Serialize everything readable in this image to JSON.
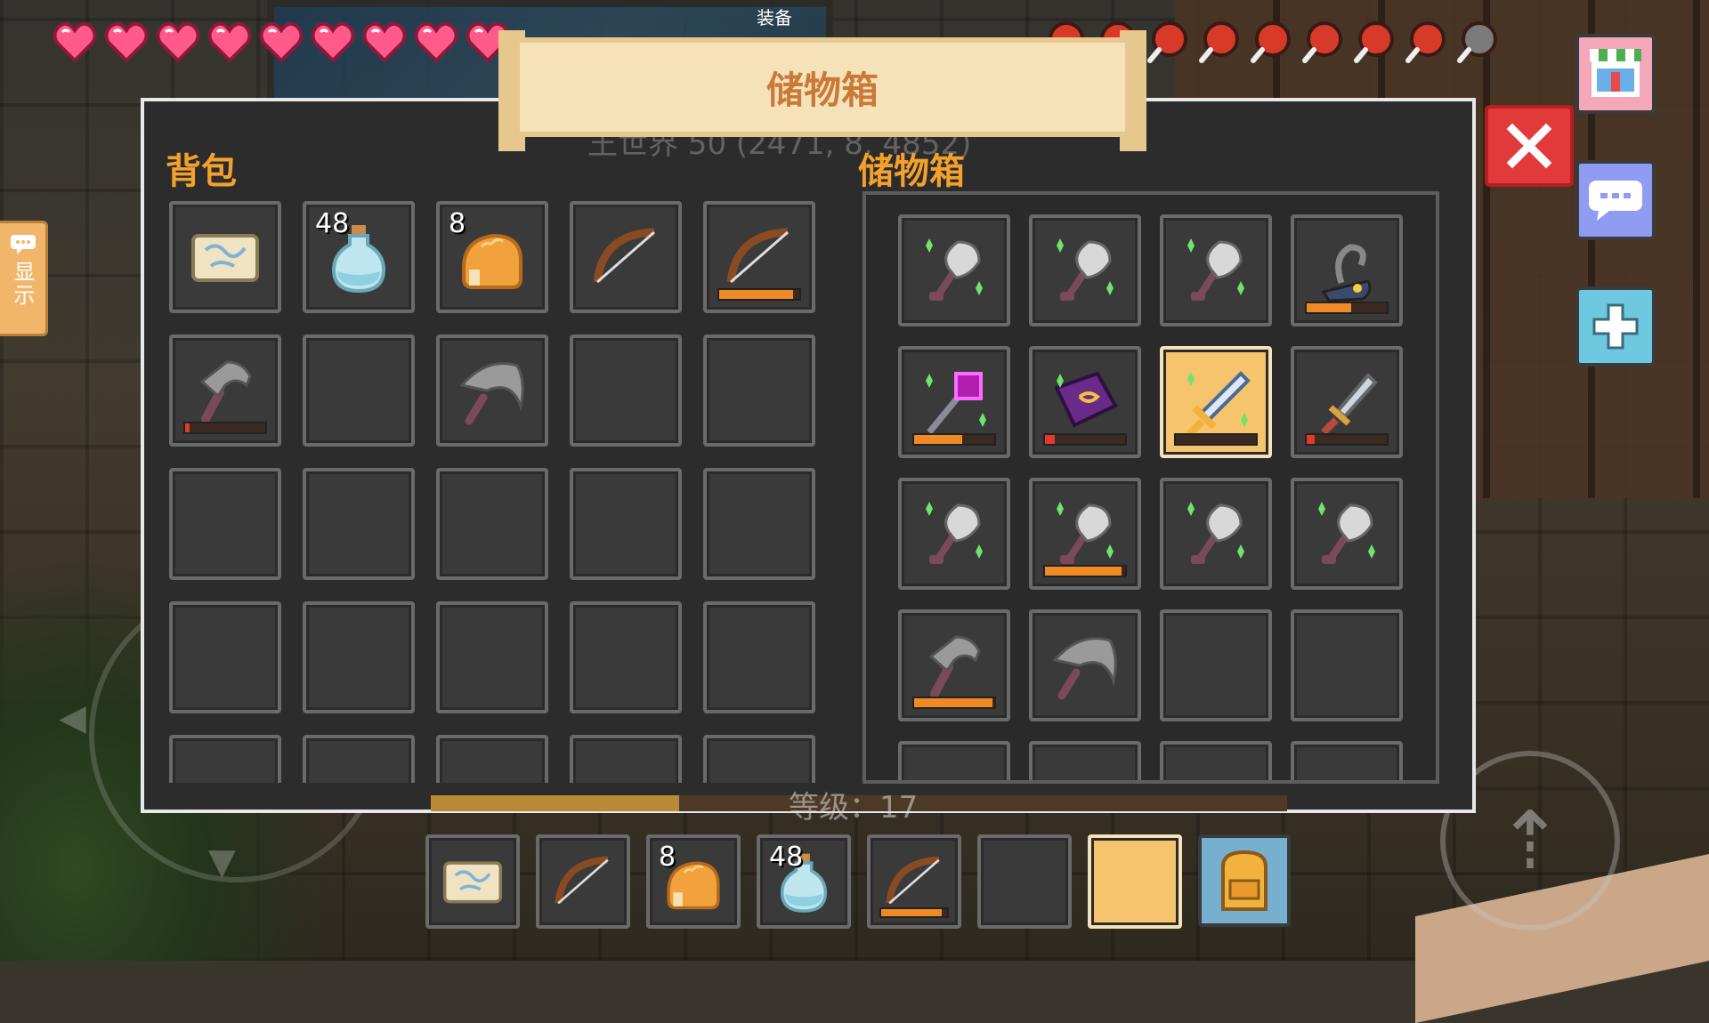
{
  "hud": {
    "equip_label": "装备",
    "hearts": 9,
    "food_full": 8,
    "food_empty": 1
  },
  "banner": {
    "title": "储物箱"
  },
  "backpack": {
    "title": "背包",
    "slots": [
      {
        "item": "map-icon"
      },
      {
        "item": "potion-icon",
        "count": "48"
      },
      {
        "item": "bread-icon",
        "count": "8"
      },
      {
        "item": "bow-icon"
      },
      {
        "item": "bow-icon",
        "durability": 0.92,
        "dur_color": "#f08a24"
      },
      {
        "item": "hammer-icon",
        "durability": 0.05,
        "dur_color": "#e03a2a"
      },
      {
        "item": "empty"
      },
      {
        "item": "pickaxe-icon"
      },
      {
        "item": "empty"
      },
      {
        "item": "empty"
      },
      {
        "item": "empty"
      },
      {
        "item": "empty"
      },
      {
        "item": "empty"
      },
      {
        "item": "empty"
      },
      {
        "item": "empty"
      },
      {
        "item": "empty"
      },
      {
        "item": "empty"
      },
      {
        "item": "empty"
      },
      {
        "item": "empty"
      },
      {
        "item": "empty"
      },
      {
        "item": "empty"
      },
      {
        "item": "empty"
      },
      {
        "item": "empty"
      },
      {
        "item": "empty"
      },
      {
        "item": "empty"
      }
    ]
  },
  "chest": {
    "title": "储物箱",
    "slots": [
      {
        "item": "shovel-icon"
      },
      {
        "item": "shovel-icon"
      },
      {
        "item": "shovel-icon"
      },
      {
        "item": "grapple-icon",
        "durability": 0.55,
        "dur_color": "#f08a24"
      },
      {
        "item": "staff-icon",
        "durability": 0.6,
        "dur_color": "#f08a24"
      },
      {
        "item": "spellbook-icon",
        "durability": 0.12,
        "dur_color": "#e03a2a"
      },
      {
        "item": "sword-gold-icon",
        "selected": true,
        "durability": 0.0,
        "dur_color": "#e03a2a"
      },
      {
        "item": "dagger-icon",
        "durability": 0.1,
        "dur_color": "#e03a2a"
      },
      {
        "item": "shovel-icon"
      },
      {
        "item": "shovel-icon",
        "durability": 0.95,
        "dur_color": "#f08a24"
      },
      {
        "item": "shovel-icon"
      },
      {
        "item": "shovel-icon"
      },
      {
        "item": "hammer-icon",
        "durability": 0.98,
        "dur_color": "#f08a24"
      },
      {
        "item": "pickaxe-icon"
      },
      {
        "item": "empty"
      },
      {
        "item": "empty"
      },
      {
        "item": "empty"
      },
      {
        "item": "empty"
      },
      {
        "item": "empty"
      },
      {
        "item": "empty"
      }
    ]
  },
  "ghost_text": "王世界 50 (2471, 8, 4852)",
  "level": {
    "label": "等级：17",
    "progress": 0.29
  },
  "hotbar": [
    {
      "item": "map-icon"
    },
    {
      "item": "bow-icon"
    },
    {
      "item": "bread-icon",
      "count": "8"
    },
    {
      "item": "potion-icon",
      "count": "48"
    },
    {
      "item": "bow-icon",
      "durability": 0.92,
      "dur_color": "#f08a24"
    },
    {
      "item": "empty"
    },
    {
      "item": "empty",
      "selected": true
    }
  ],
  "side": {
    "show_label": "显示"
  },
  "colors": {
    "accent": "#f3a12c",
    "close": "#e23a3a",
    "heart": "#ff5a8a"
  }
}
